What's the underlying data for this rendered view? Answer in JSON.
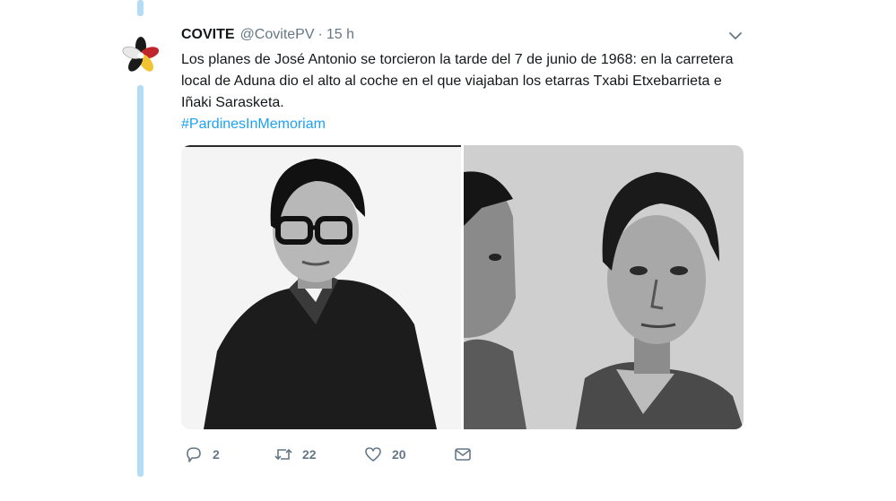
{
  "colors": {
    "thread_line": "#b3dcf7",
    "link": "#1da1f2",
    "secondary_text": "#657786",
    "primary_text": "#14171a"
  },
  "tweet": {
    "author_name": "COVITE",
    "handle": "@CovitePV",
    "separator": "·",
    "time": "15 h",
    "text": "Los planes de José Antonio se torcieron la tarde del 7 de junio de 1968: en la carretera local de Aduna dio el alto al coche en el que viajaban los etarras Txabi Etxebarrieta e Iñaki Sarasketa.",
    "hashtag": "#PardinesInMemoriam",
    "avatar_icon": "covite-logo-icon",
    "menu_icon": "chevron-down-icon",
    "media": [
      {
        "icon": "black-and-white-portrait-photo"
      },
      {
        "icon": "black-and-white-mugshot-photo"
      }
    ]
  },
  "actions": {
    "reply": {
      "icon": "reply-icon",
      "count": "2"
    },
    "retweet": {
      "icon": "retweet-icon",
      "count": "22"
    },
    "like": {
      "icon": "heart-icon",
      "count": "20"
    },
    "message": {
      "icon": "direct-message-icon"
    }
  }
}
